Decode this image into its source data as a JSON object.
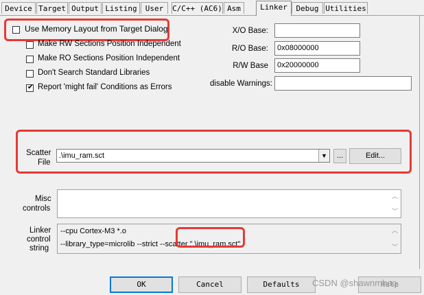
{
  "tabs": [
    {
      "label": "Device"
    },
    {
      "label": "Target"
    },
    {
      "label": "Output"
    },
    {
      "label": "Listing"
    },
    {
      "label": "User"
    },
    {
      "label": "C/C++ (AC6)"
    },
    {
      "label": "Asm"
    },
    {
      "label": "Linker"
    },
    {
      "label": "Debug"
    },
    {
      "label": "Utilities"
    }
  ],
  "options": {
    "use_memory_layout": {
      "label": "Use Memory Layout from Target Dialog",
      "checked": false
    },
    "rw_position_independent": {
      "label": "Make RW Sections Position Independent",
      "checked": false
    },
    "ro_position_independent": {
      "label": "Make RO Sections Position Independent",
      "checked": false
    },
    "dont_search_std_libs": {
      "label": "Don't Search Standard Libraries",
      "checked": false
    },
    "report_might_fail": {
      "label": "Report 'might fail' Conditions as Errors",
      "checked": true
    },
    "check_mark": "✔"
  },
  "bases": {
    "xo_label": "X/O Base:",
    "xo_value": "",
    "ro_label": "R/O Base:",
    "ro_value": "0x08000000",
    "rw_label": "R/W Base",
    "rw_value": "0x20000000",
    "warn_label": "disable Warnings:",
    "warn_value": ""
  },
  "scatter": {
    "label_line1": "Scatter",
    "label_line2": "File",
    "value": ".\\imu_ram.sct",
    "browse_label": "...",
    "edit_label": "Edit..."
  },
  "misc": {
    "label_line1": "Misc",
    "label_line2": "controls",
    "value": ""
  },
  "control_string": {
    "label_line1": "Linker",
    "label_line2": "control",
    "label_line3": "string",
    "line1": "--cpu Cortex-M3 *.o",
    "line2_prefix": "--library_type=microlib --strict --scatter ",
    "line2_highlight": "\".\\imu_ram.sct\""
  },
  "buttons": {
    "ok": "OK",
    "cancel": "Cancel",
    "defaults": "Defaults",
    "help": "Help"
  },
  "watermark": "CSDN @shawnmhao",
  "colors": {
    "highlight": "#e53935",
    "default_border": "#0078d7"
  }
}
